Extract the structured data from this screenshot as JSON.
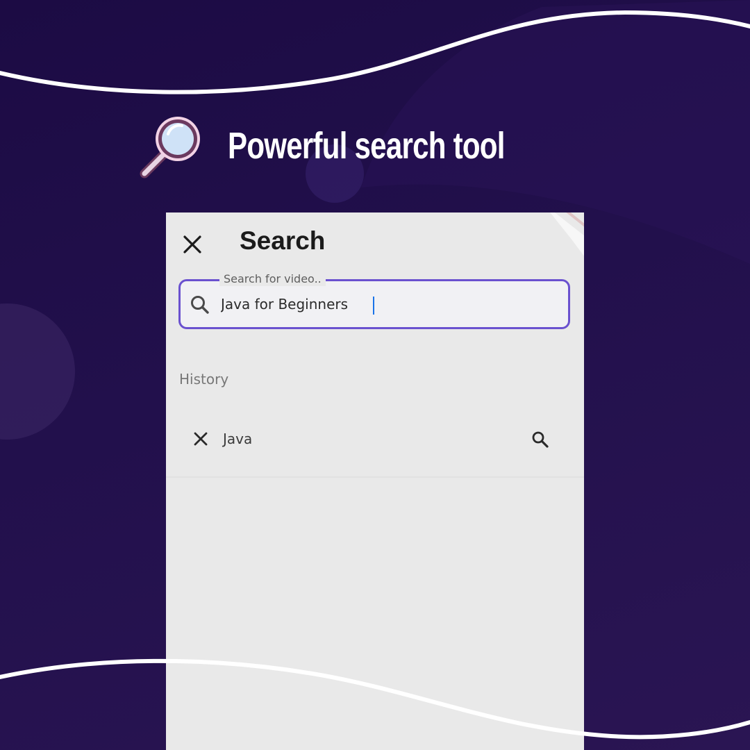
{
  "colors": {
    "background": "#1f0d48",
    "accent": "#6a51cf",
    "panel": "#e9e9e9",
    "caret": "#1a73e8"
  },
  "headline": {
    "icon": "magnifying-glass-icon",
    "text": "Powerful search tool"
  },
  "app": {
    "close_icon": "close-icon",
    "title": "Search",
    "search": {
      "legend": "Search for video..",
      "value": "Java for Beginners",
      "icon": "search-icon"
    },
    "history": {
      "label": "History",
      "items": [
        {
          "text": "Java",
          "remove_icon": "close-icon",
          "search_icon": "search-icon"
        }
      ]
    }
  }
}
